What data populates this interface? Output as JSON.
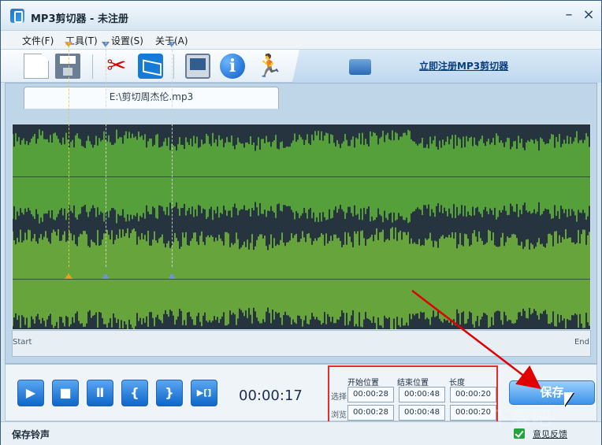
{
  "window": {
    "title": "MP3剪切器 - 未注册",
    "minimize_symbol": "–",
    "close_symbol": "×"
  },
  "menu": [
    {
      "label": "文件(F)"
    },
    {
      "label": "工具(T)"
    },
    {
      "label": "设置(S)"
    },
    {
      "label": "关于(A)"
    }
  ],
  "toolbar": {
    "register_link": "立即注册MP3剪切器",
    "icons": [
      "new-file-icon",
      "save-icon",
      "scissors-icon",
      "mail-icon",
      "monitor-icon",
      "info-icon",
      "running-person-icon",
      "register-card-icon"
    ],
    "info_symbol": "i",
    "cut_symbol": "✂",
    "runner_symbol": "🏃"
  },
  "editor": {
    "tab_label": "E:\\剪切周杰伦.mp3",
    "ruler": {
      "start": "Start",
      "end": "End"
    },
    "waveform": {
      "top_color": "#6fdb39",
      "bottom_color": "#8be13a",
      "background_color": "#25343f"
    },
    "markers": [
      {
        "type": "playhead",
        "color": "#e6a120"
      },
      {
        "type": "selection-start",
        "color": "#6087c4"
      },
      {
        "type": "selection-end",
        "color": "#6087c4"
      }
    ]
  },
  "playback": {
    "buttons": [
      {
        "name": "play",
        "symbol": "▶"
      },
      {
        "name": "stop",
        "symbol": "■"
      },
      {
        "name": "pause",
        "symbol": "Ⅱ"
      },
      {
        "name": "set-start",
        "symbol": "{"
      },
      {
        "name": "set-end",
        "symbol": "}"
      },
      {
        "name": "play-selection",
        "symbol": "▶[]"
      }
    ],
    "current_time": "00:00:17"
  },
  "selection": {
    "headers": {
      "start": "开始位置",
      "end": "结束位置",
      "length": "长度"
    },
    "rows": [
      {
        "label": "选择",
        "start": "00:00:28",
        "end": "00:00:48",
        "length": "00:00:20"
      },
      {
        "label": "浏览",
        "start": "00:00:28",
        "end": "00:00:48",
        "length": "00:00:20"
      }
    ]
  },
  "save_button": "保存",
  "status": {
    "left_text": "保存铃声",
    "feedback": "意见反馈"
  },
  "watermark": "下载吧"
}
